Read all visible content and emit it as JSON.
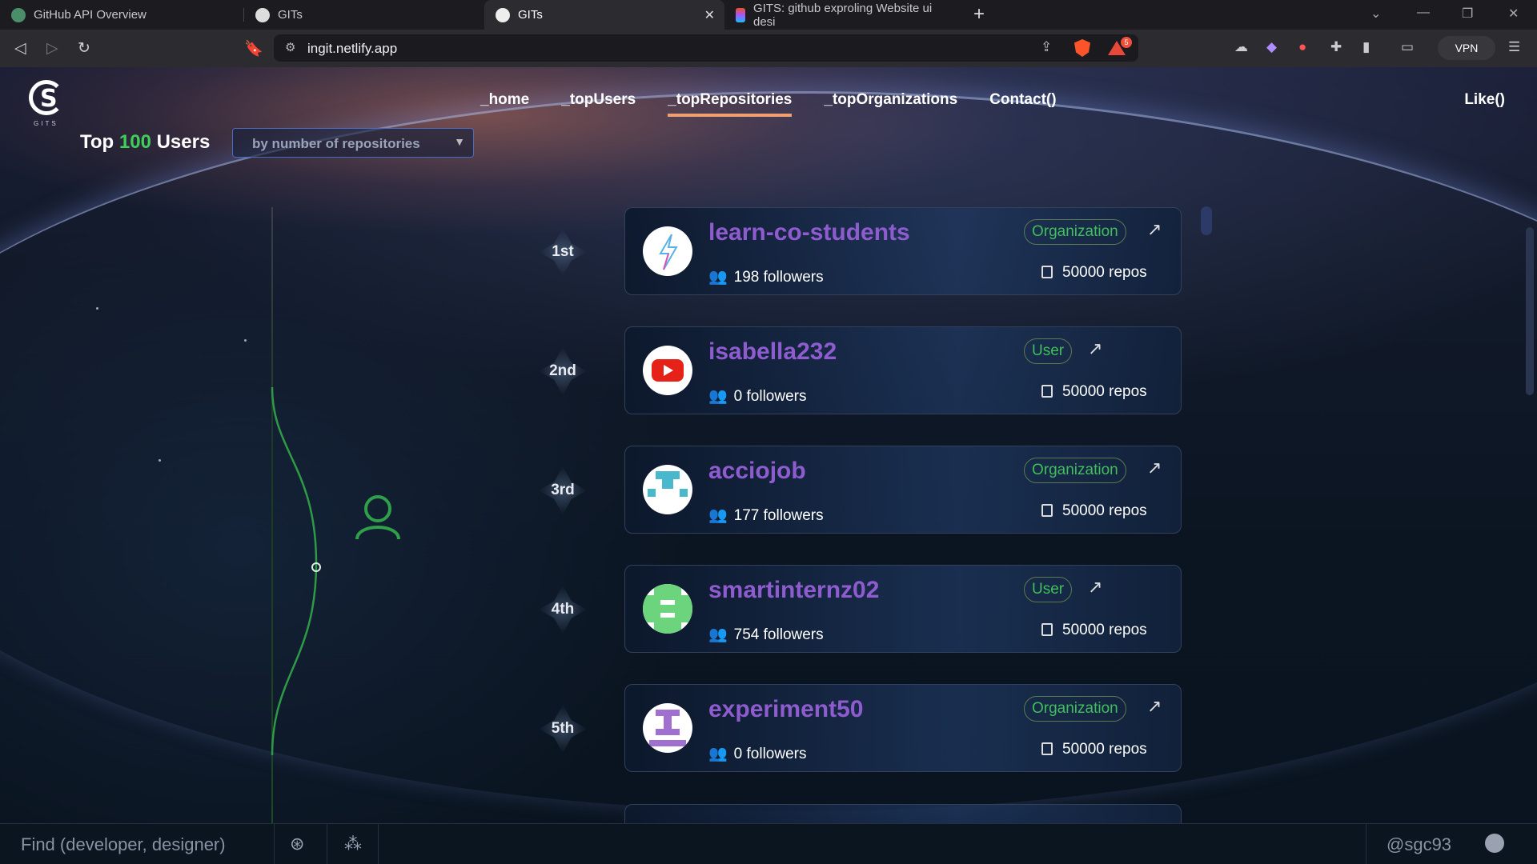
{
  "browser": {
    "tabs": [
      {
        "title": "GitHub API Overview",
        "active": false
      },
      {
        "title": "GITs",
        "active": false
      },
      {
        "title": "GITs",
        "active": true
      },
      {
        "title": "GITS: github exproling Website ui desi",
        "active": false
      }
    ],
    "url": "ingit.netlify.app",
    "vpn_label": "VPN",
    "notification_count": "5"
  },
  "site": {
    "logo_text": "GITS",
    "nav": [
      {
        "label": "_home",
        "active": false
      },
      {
        "label": "_topUsers",
        "active": false
      },
      {
        "label": "_topRepositories",
        "active": true
      },
      {
        "label": "_topOrganizations",
        "active": false
      },
      {
        "label": "Contact()",
        "active": false
      }
    ],
    "like_label": "Like()"
  },
  "heading": {
    "prefix": "Top",
    "count": "100",
    "suffix": "Users"
  },
  "sort": {
    "selected": "by number of repositories"
  },
  "ranking": [
    {
      "rank": "1st",
      "name": "learn-co-students",
      "type": "Organization",
      "followers": "198 followers",
      "repos": "50000 repos"
    },
    {
      "rank": "2nd",
      "name": "isabella232",
      "type": "User",
      "followers": "0 followers",
      "repos": "50000 repos"
    },
    {
      "rank": "3rd",
      "name": "acciojob",
      "type": "Organization",
      "followers": "177 followers",
      "repos": "50000 repos"
    },
    {
      "rank": "4th",
      "name": "smartinternz02",
      "type": "User",
      "followers": "754 followers",
      "repos": "50000 repos"
    },
    {
      "rank": "5th",
      "name": "experiment50",
      "type": "Organization",
      "followers": "0 followers",
      "repos": "50000 repos"
    }
  ],
  "footer": {
    "find_placeholder": "Find (developer, designer)",
    "handle": "@sgc93"
  },
  "colors": {
    "accent_green": "#3ecf5a",
    "name_purple": "#8e5ccf",
    "nav_underline": "#f0a070"
  }
}
